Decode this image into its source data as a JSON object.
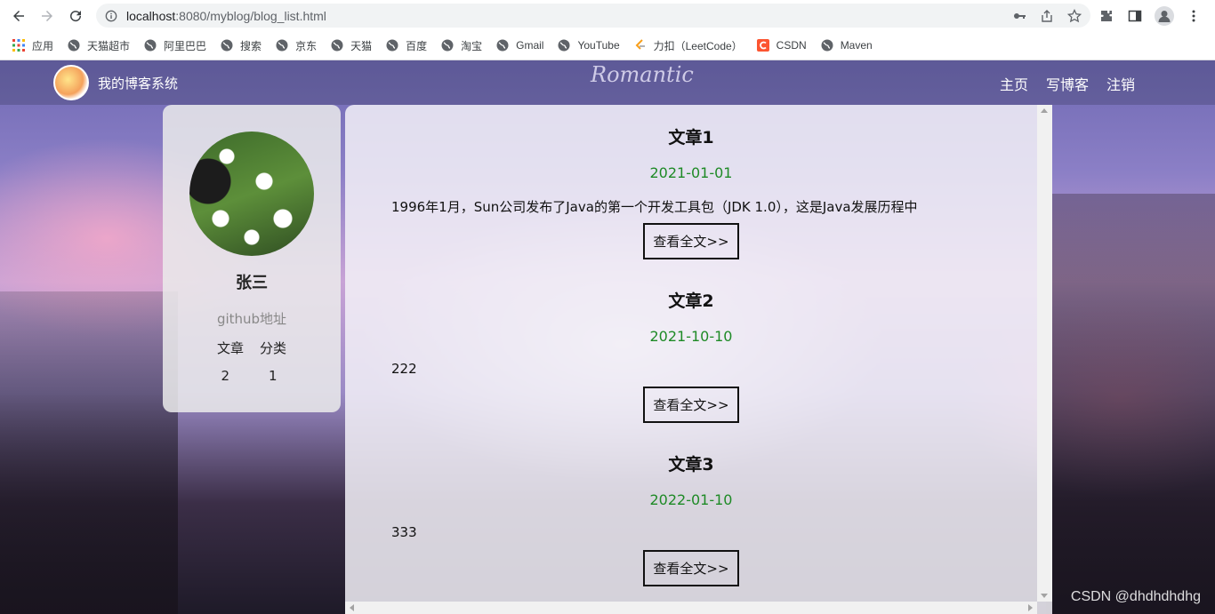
{
  "browser": {
    "url_host": "localhost",
    "url_path": ":8080/myblog/blog_list.html",
    "bookmarks": [
      "应用",
      "天猫超市",
      "阿里巴巴",
      "搜索",
      "京东",
      "天猫",
      "百度",
      "淘宝",
      "Gmail",
      "YouTube",
      "力扣（LeetCode）",
      "CSDN",
      "Maven"
    ]
  },
  "navbar": {
    "site_title": "我的博客系统",
    "banner_text": "Romantic",
    "links": [
      "主页",
      "写博客",
      "注销"
    ]
  },
  "profile": {
    "name": "张三",
    "github": "github地址",
    "stats_labels": [
      "文章",
      "分类"
    ],
    "stats_values": [
      "2",
      "1"
    ]
  },
  "blogs": [
    {
      "title": "文章1",
      "date": "2021-01-01",
      "desc": "1996年1月，Sun公司发布了Java的第一个开发工具包（JDK 1.0），这是Java发展历程中",
      "more": "查看全文>>"
    },
    {
      "title": "文章2",
      "date": "2021-10-10",
      "desc": "222",
      "more": "查看全文>>"
    },
    {
      "title": "文章3",
      "date": "2022-01-10",
      "desc": "333",
      "more": "查看全文>>"
    }
  ],
  "watermark": "CSDN @dhdhdhdhg",
  "colors": {
    "date_green": "#1e8a26",
    "nav_text": "#ffffff"
  }
}
